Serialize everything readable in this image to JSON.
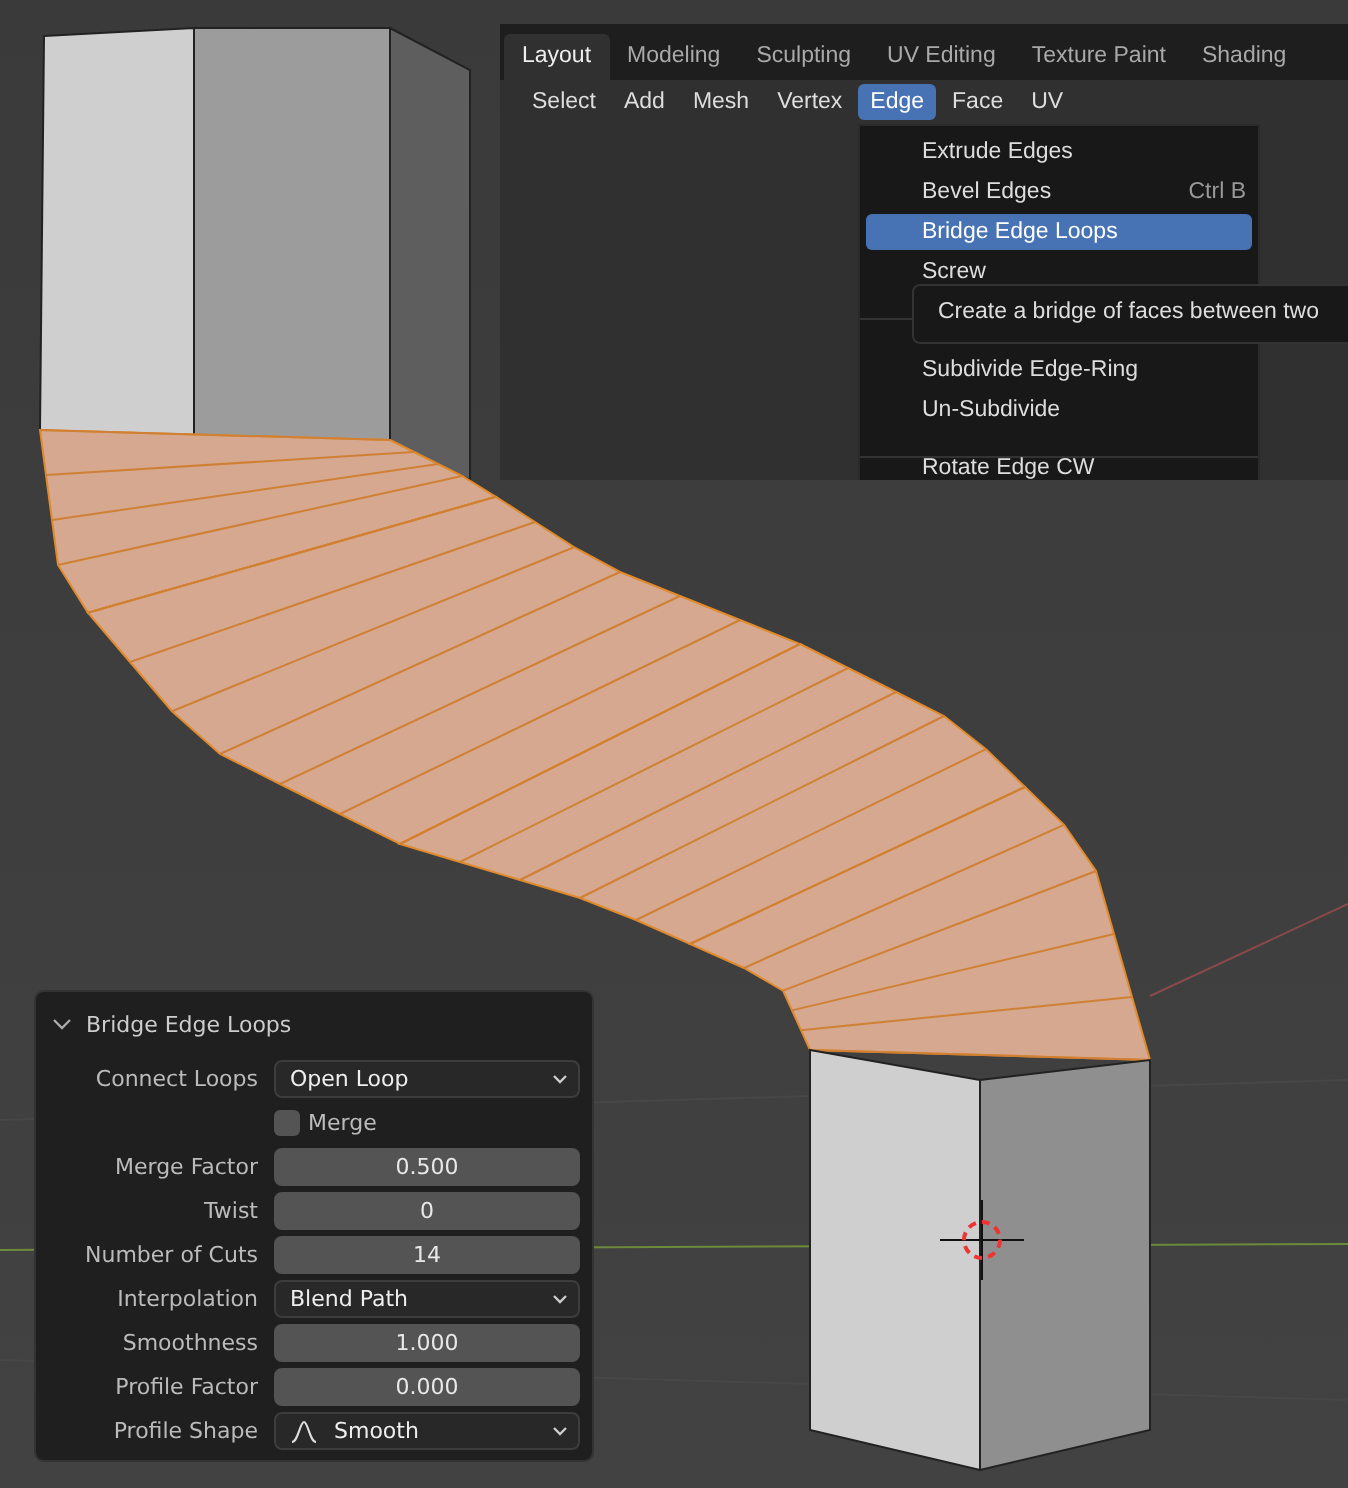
{
  "workspace_tabs": [
    {
      "label": "Layout",
      "selected": true
    },
    {
      "label": "Modeling",
      "selected": false
    },
    {
      "label": "Sculpting",
      "selected": false
    },
    {
      "label": "UV Editing",
      "selected": false
    },
    {
      "label": "Texture Paint",
      "selected": false
    },
    {
      "label": "Shading",
      "selected": false
    }
  ],
  "menu_bar": [
    {
      "label": "Select",
      "selected": false
    },
    {
      "label": "Add",
      "selected": false
    },
    {
      "label": "Mesh",
      "selected": false
    },
    {
      "label": "Vertex",
      "selected": false
    },
    {
      "label": "Edge",
      "selected": true
    },
    {
      "label": "Face",
      "selected": false
    },
    {
      "label": "UV",
      "selected": false
    }
  ],
  "edge_menu": [
    {
      "kind": "item",
      "label": "Extrude Edges",
      "selected": false
    },
    {
      "kind": "item",
      "label": "Bevel Edges",
      "shortcut": "Ctrl B",
      "selected": false
    },
    {
      "kind": "item",
      "label": "Bridge Edge Loops",
      "selected": true
    },
    {
      "kind": "item",
      "label": "Screw",
      "selected": false
    },
    {
      "kind": "separator"
    },
    {
      "kind": "item",
      "label": "Subdivide Edge-Ring",
      "selected": false
    },
    {
      "kind": "item",
      "label": "Un-Subdivide",
      "selected": false
    },
    {
      "kind": "separator"
    },
    {
      "kind": "item",
      "label": "Rotate Edge CW",
      "selected": false
    }
  ],
  "tooltip": {
    "text": "Create a bridge of faces between two"
  },
  "operator_panel": {
    "title": "Bridge Edge Loops",
    "expanded": true,
    "fields": [
      {
        "kind": "dropdown",
        "label": "Connect Loops",
        "value": "Open Loop"
      },
      {
        "kind": "checkbox",
        "label": "Merge",
        "checked": false
      },
      {
        "kind": "number",
        "label": "Merge Factor",
        "value": "0.500"
      },
      {
        "kind": "number",
        "label": "Twist",
        "value": "0"
      },
      {
        "kind": "number",
        "label": "Number of Cuts",
        "value": "14"
      },
      {
        "kind": "dropdown",
        "label": "Interpolation",
        "value": "Blend Path"
      },
      {
        "kind": "number",
        "label": "Smoothness",
        "value": "1.000"
      },
      {
        "kind": "number",
        "label": "Profile Factor",
        "value": "0.000"
      },
      {
        "kind": "dropdown",
        "label": "Profile Shape",
        "value": "Smooth",
        "icon": true
      }
    ]
  }
}
